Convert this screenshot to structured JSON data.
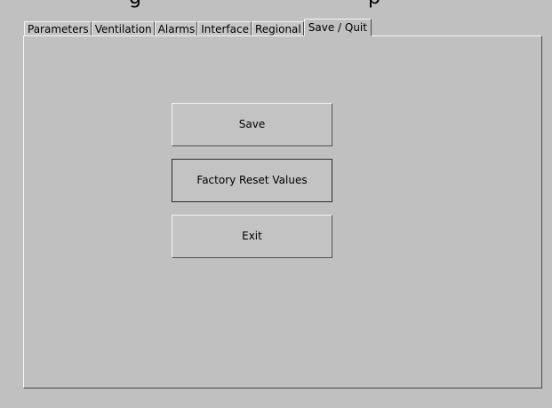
{
  "window": {
    "title_fragment_left": "g",
    "title_fragment_right": "p"
  },
  "tabs": [
    {
      "label": "Parameters",
      "active": false
    },
    {
      "label": "Ventilation",
      "active": false
    },
    {
      "label": "Alarms",
      "active": false
    },
    {
      "label": "Interface",
      "active": false
    },
    {
      "label": "Regional",
      "active": false
    },
    {
      "label": "Save / Quit",
      "active": true
    }
  ],
  "actions": {
    "save_label": "Save",
    "reset_label": "Factory Reset Values",
    "exit_label": "Exit"
  }
}
